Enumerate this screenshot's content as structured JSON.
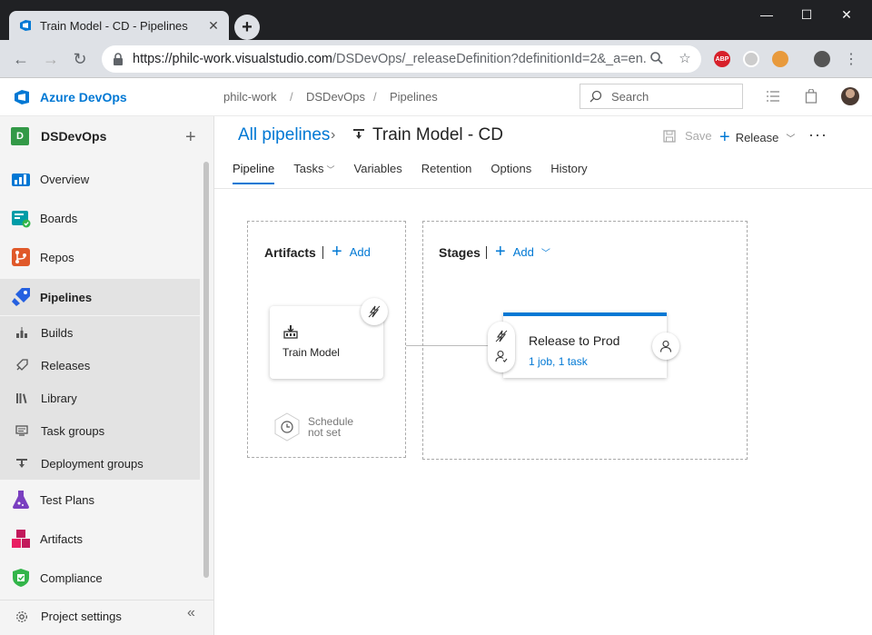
{
  "browser": {
    "tab_title": "Train Model - CD - Pipelines",
    "url_host": "https://philc-work.visualstudio.com",
    "url_path": "/DSDevOps/_releaseDefinition?definitionId=2&_a=en...",
    "extensions": [
      "ABP"
    ]
  },
  "header": {
    "product": "Azure DevOps",
    "breadcrumbs": [
      "philc-work",
      "DSDevOps",
      "Pipelines"
    ],
    "search_placeholder": "Search"
  },
  "sidebar": {
    "project_initial": "D",
    "project_name": "DSDevOps",
    "items": [
      {
        "label": "Overview",
        "icon": "overview-icon"
      },
      {
        "label": "Boards",
        "icon": "boards-icon"
      },
      {
        "label": "Repos",
        "icon": "repos-icon"
      },
      {
        "label": "Pipelines",
        "icon": "pipelines-icon"
      }
    ],
    "sub_items": [
      {
        "label": "Builds",
        "icon": "builds-icon"
      },
      {
        "label": "Releases",
        "icon": "releases-icon"
      },
      {
        "label": "Library",
        "icon": "library-icon"
      },
      {
        "label": "Task groups",
        "icon": "task-groups-icon"
      },
      {
        "label": "Deployment groups",
        "icon": "deployment-groups-icon"
      }
    ],
    "lower_items": [
      {
        "label": "Test Plans",
        "icon": "test-plans-icon"
      },
      {
        "label": "Artifacts",
        "icon": "artifacts-icon"
      },
      {
        "label": "Compliance",
        "icon": "compliance-icon"
      }
    ],
    "settings_label": "Project settings"
  },
  "main": {
    "all_pipelines": "All pipelines",
    "pipeline_title": "Train Model - CD",
    "save_label": "Save",
    "release_label": "Release",
    "tabs": [
      "Pipeline",
      "Tasks",
      "Variables",
      "Retention",
      "Options",
      "History"
    ],
    "artifacts": {
      "title": "Artifacts",
      "add_label": "Add",
      "artifact_name": "Train Model",
      "schedule_line1": "Schedule",
      "schedule_line2": "not set"
    },
    "stages": {
      "title": "Stages",
      "add_label": "Add",
      "stage_name": "Release to Prod",
      "stage_sub": "1 job, 1 task"
    }
  },
  "colors": {
    "accent": "#0078d4",
    "project_badge": "#339947",
    "chrome_dark": "#202124",
    "chrome_light": "#dee1e6"
  }
}
